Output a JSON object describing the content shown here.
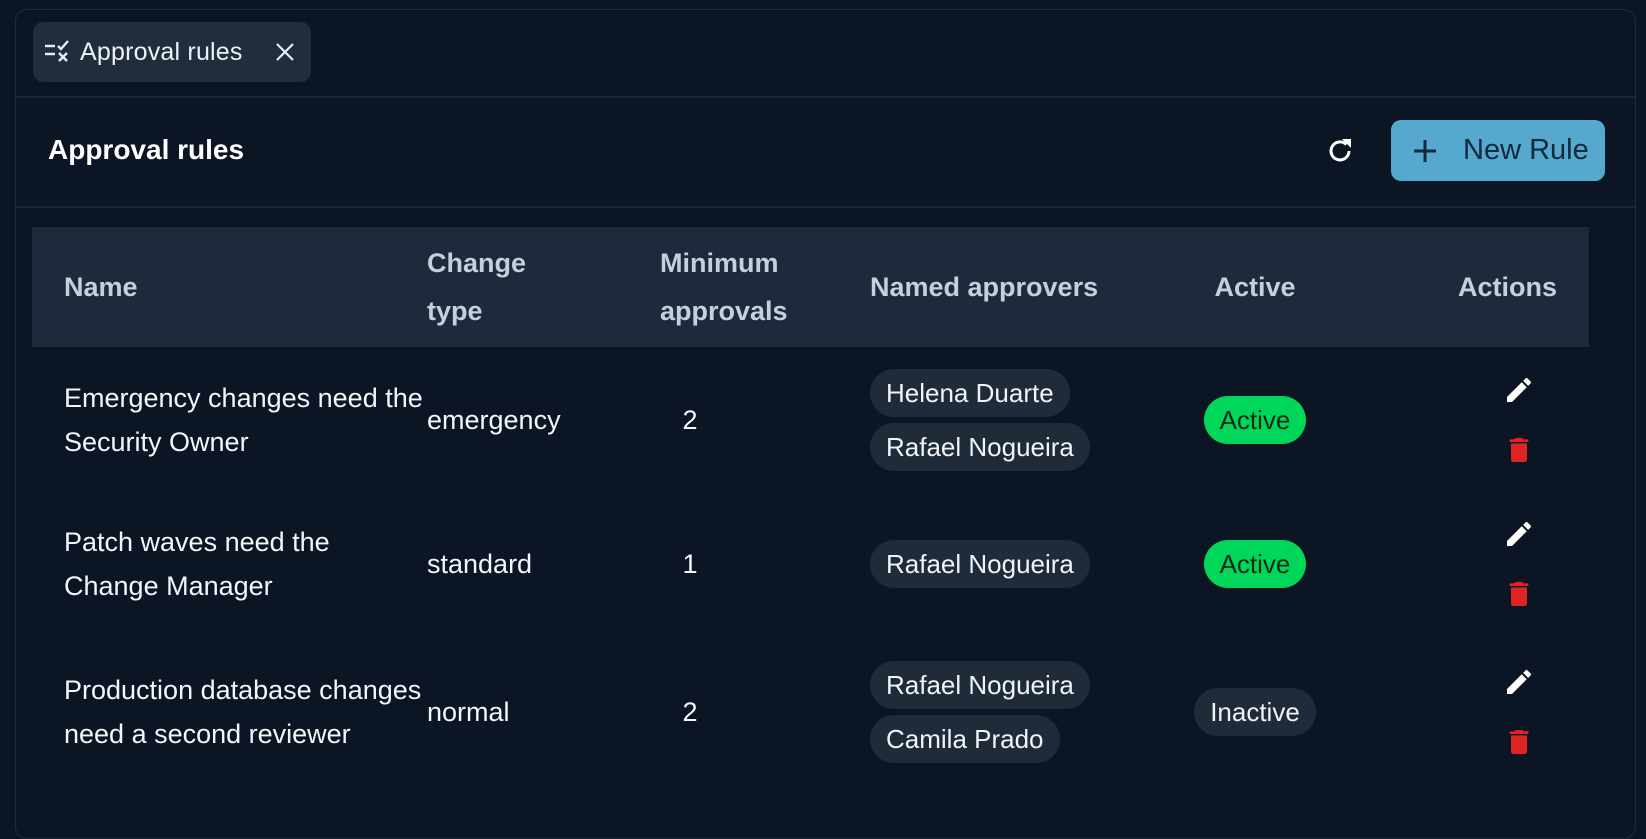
{
  "tab": {
    "label": "Approval rules",
    "icon": "rule-list-icon",
    "close_icon": "close-icon"
  },
  "header": {
    "title": "Approval rules",
    "refresh_icon": "refresh-icon",
    "new_rule_label": "New Rule",
    "new_rule_icon": "plus-icon"
  },
  "table": {
    "columns": {
      "name": "Name",
      "change_type": "Change type",
      "minimum_approvals": "Minimum approvals",
      "named_approvers": "Named approvers",
      "active": "Active",
      "actions": "Actions"
    },
    "rows": [
      {
        "name": "Emergency changes need the Security Owner",
        "change_type": "emergency",
        "minimum_approvals": "2",
        "approvers": [
          "Helena Duarte",
          "Rafael Nogueira"
        ],
        "status": "Active"
      },
      {
        "name": "Patch waves need the Change Manager",
        "change_type": "standard",
        "minimum_approvals": "1",
        "approvers": [
          "Rafael Nogueira"
        ],
        "status": "Active"
      },
      {
        "name": "Production database changes need a second reviewer",
        "change_type": "normal",
        "minimum_approvals": "2",
        "approvers": [
          "Rafael Nogueira",
          "Camila Prado"
        ],
        "status": "Inactive"
      }
    ]
  },
  "colors": {
    "background": "#0c1524",
    "header_row": "#1c2a3b",
    "primary_button": "#56a8cf",
    "active_badge": "#00d65a",
    "delete_icon": "#e02424"
  }
}
